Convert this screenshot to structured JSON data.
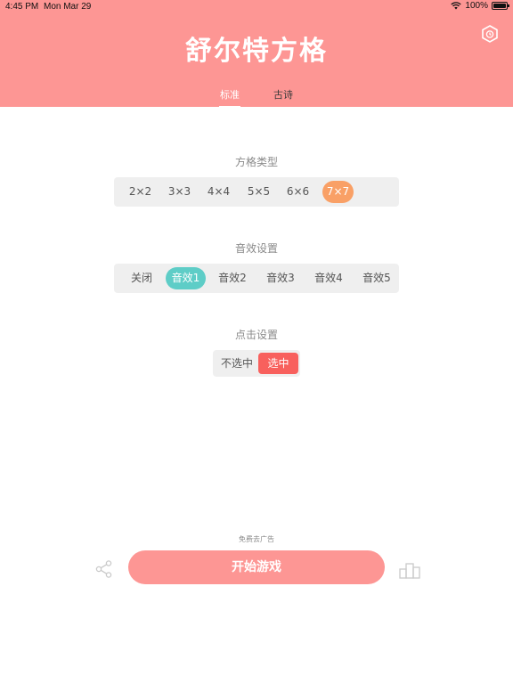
{
  "status_bar": {
    "time": "4:45 PM",
    "date": "Mon Mar 29",
    "battery": "100%"
  },
  "header": {
    "title": "舒尔特方格",
    "tabs": [
      "标准",
      "古诗"
    ]
  },
  "grid_type": {
    "label": "方格类型",
    "options": [
      "2×2",
      "3×3",
      "4×4",
      "5×5",
      "6×6",
      "7×7"
    ],
    "selected": "7×7"
  },
  "sound": {
    "label": "音效设置",
    "options": [
      "关闭",
      "音效1",
      "音效2",
      "音效3",
      "音效4",
      "音效5"
    ],
    "selected": "音效1"
  },
  "click": {
    "label": "点击设置",
    "options": [
      "不选中",
      "选中"
    ],
    "selected": "选中"
  },
  "footer": {
    "ad_text": "免费去广告",
    "start_label": "开始游戏"
  },
  "colors": {
    "brand": "#fd9694",
    "orange": "#f9a066",
    "teal": "#5ecdc7",
    "red": "#f8605d"
  }
}
